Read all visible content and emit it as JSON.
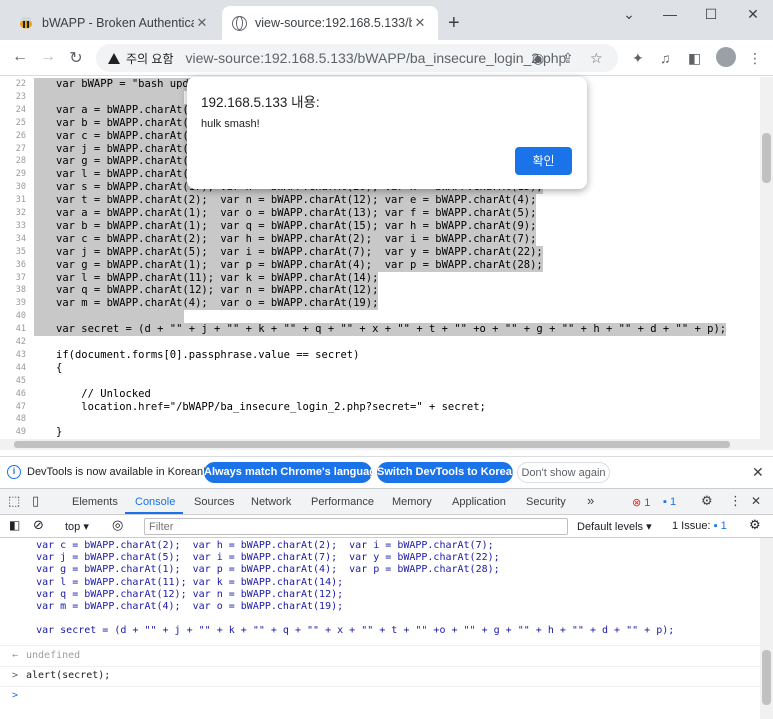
{
  "tabs": [
    {
      "title": "bWAPP - Broken Authentication",
      "icon": "bee-icon"
    },
    {
      "title": "view-source:192.168.5.133/bWA",
      "icon": "globe-icon"
    }
  ],
  "window_controls": {
    "minimize": "—",
    "maximize": "☐",
    "close": "✕",
    "dropdown": "⌄"
  },
  "toolbar": {
    "security_label": "주의 요함",
    "url": "view-source:192.168.5.133/bWAPP/ba_insecure_login_2.php"
  },
  "source_lines": [
    {
      "no": "22",
      "code": "var bWAPP = \"bash update killed my shells!\"",
      "sel": true
    },
    {
      "no": "23",
      "code": "",
      "sel": true
    },
    {
      "no": "24",
      "code": "var a = bWAPP.charAt(0);  var d = bWAPP.charAt(3);  var r = bWAPP.charAt(16);",
      "sel": true
    },
    {
      "no": "25",
      "code": "var b = bWAPP.charAt(1);  var e = bWAPP.charAt(4);  var j = bWAPP.charAt(9);",
      "sel": true
    },
    {
      "no": "26",
      "code": "var c = bWAPP.charAt(2);  var f = bWAPP.charAt(5);  var g = bWAPP.charAt(4);",
      "sel": true
    },
    {
      "no": "27",
      "code": "var j = bWAPP.charAt(9);  var h = bWAPP.charAt(6);  var m = bWAPP.charAt(16);",
      "sel": true
    },
    {
      "no": "28",
      "code": "var g = bWAPP.charAt(4);  var i = bWAPP.charAt(7);  var n = bWAPP.charAt(18);",
      "sel": true
    },
    {
      "no": "29",
      "code": "var l = bWAPP.charAt(11); var g = bWAPP.charAt(4);  var y = bWAPP.charAt(11);",
      "sel": true
    },
    {
      "no": "30",
      "code": "var s = bWAPP.charAt(17); var h = bWAPP.charAt(20); var x = bWAPP.charAt(15);",
      "sel": true
    },
    {
      "no": "31",
      "code": "var t = bWAPP.charAt(2);  var n = bWAPP.charAt(12); var e = bWAPP.charAt(4);",
      "sel": true
    },
    {
      "no": "32",
      "code": "var a = bWAPP.charAt(1);  var o = bWAPP.charAt(13); var f = bWAPP.charAt(5);",
      "sel": true
    },
    {
      "no": "33",
      "code": "var b = bWAPP.charAt(1);  var q = bWAPP.charAt(15); var h = bWAPP.charAt(9);",
      "sel": true
    },
    {
      "no": "34",
      "code": "var c = bWAPP.charAt(2);  var h = bWAPP.charAt(2);  var i = bWAPP.charAt(7);",
      "sel": true
    },
    {
      "no": "35",
      "code": "var j = bWAPP.charAt(5);  var i = bWAPP.charAt(7);  var y = bWAPP.charAt(22);",
      "sel": true
    },
    {
      "no": "36",
      "code": "var g = bWAPP.charAt(1);  var p = bWAPP.charAt(4);  var p = bWAPP.charAt(28);",
      "sel": true
    },
    {
      "no": "37",
      "code": "var l = bWAPP.charAt(11); var k = bWAPP.charAt(14);",
      "sel": true
    },
    {
      "no": "38",
      "code": "var q = bWAPP.charAt(12); var n = bWAPP.charAt(12);",
      "sel": true
    },
    {
      "no": "39",
      "code": "var m = bWAPP.charAt(4);  var o = bWAPP.charAt(19);",
      "sel": true
    },
    {
      "no": "40",
      "code": "",
      "sel": true
    },
    {
      "no": "41",
      "code": "var secret = (d + \"\" + j + \"\" + k + \"\" + q + \"\" + x + \"\" + t + \"\" +o + \"\" + g + \"\" + h + \"\" + d + \"\" + p);",
      "sel": true
    },
    {
      "no": "42",
      "code": "",
      "sel": false
    },
    {
      "no": "43",
      "code": "if(document.forms[0].passphrase.value == secret)",
      "sel": false
    },
    {
      "no": "44",
      "code": "{",
      "sel": false
    },
    {
      "no": "45",
      "code": "",
      "sel": false
    },
    {
      "no": "46",
      "code": "    // Unlocked",
      "sel": false
    },
    {
      "no": "47",
      "code": "    location.href=\"/bWAPP/ba_insecure_login_2.php?secret=\" + secret;",
      "sel": false
    },
    {
      "no": "48",
      "code": "",
      "sel": false
    },
    {
      "no": "49",
      "code": "}",
      "sel": false
    }
  ],
  "alert": {
    "title": "192.168.5.133 내용:",
    "message": "hulk smash!",
    "ok_label": "확인"
  },
  "infobar": {
    "text": "DevTools is now available in Korean!",
    "btn_match": "Always match Chrome's language",
    "btn_switch": "Switch DevTools to Korean",
    "btn_dismiss": "Don't show again"
  },
  "devtools_tabs": [
    "Elements",
    "Console",
    "Sources",
    "Network",
    "Performance",
    "Memory",
    "Application",
    "Security"
  ],
  "devtools_more": "»",
  "devtools_counts": {
    "errors": "1",
    "issues_badge": "1"
  },
  "console_toolbar": {
    "context": "top",
    "filter_placeholder": "Filter",
    "levels": "Default levels",
    "issues": "1 Issue:",
    "issues_count": "1"
  },
  "console_lines": [
    "    var c = bWAPP.charAt(2);  var h = bWAPP.charAt(2);  var i = bWAPP.charAt(7);",
    "    var j = bWAPP.charAt(5);  var i = bWAPP.charAt(7);  var y = bWAPP.charAt(22);",
    "    var g = bWAPP.charAt(1);  var p = bWAPP.charAt(4);  var p = bWAPP.charAt(28);",
    "    var l = bWAPP.charAt(11); var k = bWAPP.charAt(14);",
    "    var q = bWAPP.charAt(12); var n = bWAPP.charAt(12);",
    "    var m = bWAPP.charAt(4);  var o = bWAPP.charAt(19);",
    "",
    "    var secret = (d + \"\" + j + \"\" + k + \"\" + q + \"\" + x + \"\" + t + \"\" +o + \"\" + g + \"\" + h + \"\" + d + \"\" + p);"
  ],
  "console_result": "undefined",
  "console_input": "alert(secret);",
  "colors": {
    "accent": "#1a73e8",
    "selection": "#c8c8c8",
    "error": "#d93025"
  }
}
